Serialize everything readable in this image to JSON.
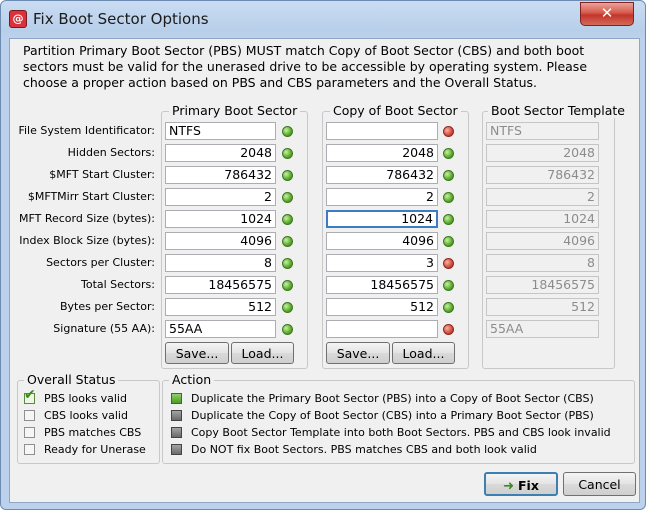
{
  "window": {
    "title": "Fix Boot Sector Options",
    "close_glyph": "✕",
    "app_icon_glyph": "@"
  },
  "description": "Partition Primary Boot Sector (PBS) MUST match Copy of Boot Sector (CBS) and both boot sectors must be valid for the unerased drive to be accessible by operating system. Please choose a proper action based on PBS and CBS parameters and the Overall Status.",
  "labels": [
    "File System Identificator:",
    "Hidden Sectors:",
    "$MFT Start Cluster:",
    "$MFTMirr Start Cluster:",
    "MFT Record Size (bytes):",
    "Index Block Size (bytes):",
    "Sectors per Cluster:",
    "Total Sectors:",
    "Bytes per Sector:",
    "Signature (55 AA):"
  ],
  "pbs": {
    "title": "Primary Boot Sector",
    "values": [
      "NTFS",
      "2048",
      "786432",
      "2",
      "1024",
      "4096",
      "8",
      "18456575",
      "512",
      "55AA"
    ],
    "status": [
      "green",
      "green",
      "green",
      "green",
      "green",
      "green",
      "green",
      "green",
      "green",
      "green"
    ],
    "save_label": "Save...",
    "load_label": "Load..."
  },
  "cbs": {
    "title": "Copy of Boot Sector",
    "values": [
      "",
      "2048",
      "786432",
      "2",
      "1024",
      "4096",
      "3",
      "18456575",
      "512",
      ""
    ],
    "status": [
      "red",
      "green",
      "green",
      "green",
      "green",
      "green",
      "red",
      "green",
      "green",
      "red"
    ],
    "save_label": "Save...",
    "load_label": "Load..."
  },
  "template": {
    "title": "Boot Sector Template",
    "values": [
      "NTFS",
      "2048",
      "786432",
      "2",
      "1024",
      "4096",
      "8",
      "18456575",
      "512",
      "55AA"
    ]
  },
  "overall_status": {
    "title": "Overall Status",
    "items": [
      {
        "label": "PBS looks valid",
        "checked": true
      },
      {
        "label": "CBS looks valid",
        "checked": false
      },
      {
        "label": "PBS matches CBS",
        "checked": false
      },
      {
        "label": "Ready for Unerase",
        "checked": false
      }
    ]
  },
  "action": {
    "title": "Action",
    "items": [
      {
        "label": "Duplicate the Primary Boot Sector (PBS) into a Copy of Boot Sector (CBS)",
        "icon": "green"
      },
      {
        "label": "Duplicate the Copy of Boot Sector (CBS) into a Primary Boot Sector (PBS)",
        "icon": "gray"
      },
      {
        "label": "Copy Boot Sector Template into both Boot Sectors. PBS and CBS look invalid",
        "icon": "gray"
      },
      {
        "label": "Do NOT fix Boot Sectors. PBS matches CBS and both look valid",
        "icon": "gray"
      }
    ]
  },
  "buttons": {
    "fix_label": "Fix",
    "cancel_label": "Cancel"
  },
  "colors": {
    "status_green": "#5aa82a",
    "status_red": "#d24a3a",
    "focus_border": "#3d7bc4"
  }
}
